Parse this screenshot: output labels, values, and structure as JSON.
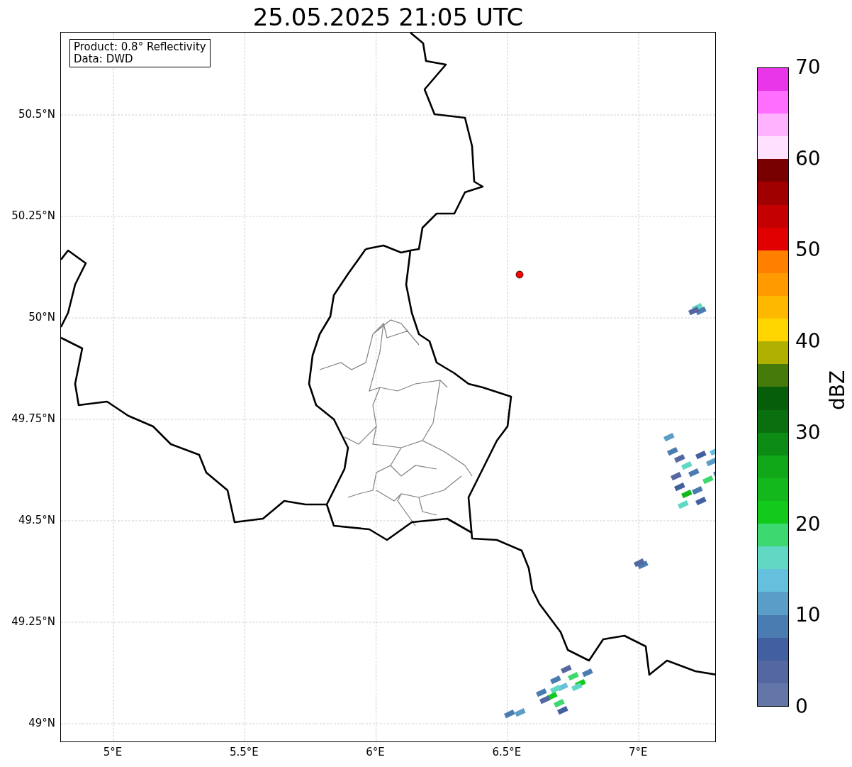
{
  "title": "25.05.2025 21:05 UTC",
  "map": {
    "info_box": [
      "Product: 0.8° Reflectivity",
      "Data: DWD"
    ],
    "x_ticks": [
      "5°E",
      "5.5°E",
      "6°E",
      "6.5°E",
      "7°E"
    ],
    "y_ticks": [
      "50.5°N",
      "50.25°N",
      "50°N",
      "49.75°N",
      "49.5°N",
      "49.25°N",
      "49°N"
    ]
  },
  "colorbar": {
    "label": "dBZ",
    "ticks": [
      "70",
      "60",
      "50",
      "40",
      "30",
      "20",
      "10",
      "0"
    ],
    "bins": [
      {
        "color": "#6476a8"
      },
      {
        "color": "#5567a0"
      },
      {
        "color": "#4260a0"
      },
      {
        "color": "#4a7cb2"
      },
      {
        "color": "#5a9ec8"
      },
      {
        "color": "#64c0dc"
      },
      {
        "color": "#60d8c4"
      },
      {
        "color": "#3ed870"
      },
      {
        "color": "#12ca1c"
      },
      {
        "color": "#12b81c"
      },
      {
        "color": "#10a818"
      },
      {
        "color": "#0c8c14"
      },
      {
        "color": "#0a700f"
      },
      {
        "color": "#065e0a"
      },
      {
        "color": "#467a0a"
      },
      {
        "color": "#b0b000"
      },
      {
        "color": "#ffd600"
      },
      {
        "color": "#ffb800"
      },
      {
        "color": "#ff9a00"
      },
      {
        "color": "#ff7f00"
      },
      {
        "color": "#e00000"
      },
      {
        "color": "#c40000"
      },
      {
        "color": "#a00000"
      },
      {
        "color": "#780000"
      },
      {
        "color": "#ffe0ff"
      },
      {
        "color": "#ffb3ff"
      },
      {
        "color": "#ff6eff"
      },
      {
        "color": "#e936e9"
      }
    ]
  }
}
